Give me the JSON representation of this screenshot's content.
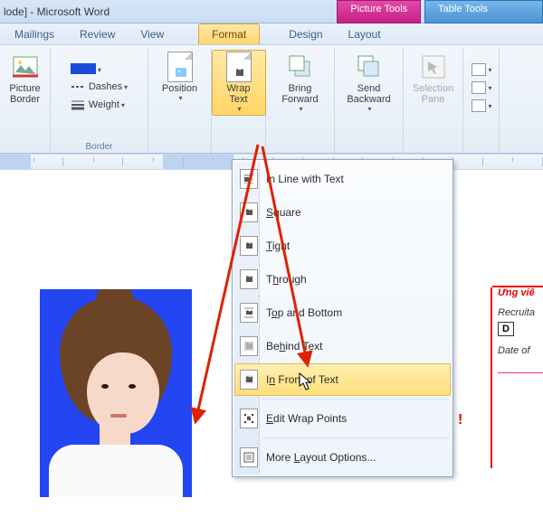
{
  "titlebar": {
    "text": "lode] - Microsoft Word"
  },
  "contextual_tabs": {
    "picture_tools": "Picture Tools",
    "table_tools": "Table Tools"
  },
  "tabs": {
    "mailings": "Mailings",
    "review": "Review",
    "view": "View",
    "format": "Format",
    "design": "Design",
    "layout": "Layout"
  },
  "ribbon": {
    "border": {
      "swatch_color": "#1b4bd8",
      "dashes": "Dashes",
      "weight": "Weight",
      "picture_border": "Picture\nBorder",
      "group": "Border"
    },
    "arrange": {
      "position": "Position",
      "wrap_text": "Wrap\nText",
      "bring_forward": "Bring\nForward",
      "send_backward": "Send\nBackward",
      "selection_pane": "Selection\nPane"
    }
  },
  "menu": {
    "inline": "In Line with Text",
    "square": "Square",
    "tight": "Tight",
    "through": "Through",
    "top_bottom": "Top and Bottom",
    "behind": "Behind Text",
    "in_front": "In Front of Text",
    "edit_points": "Edit Wrap Points",
    "more": "More Layout Options..."
  },
  "form": {
    "heading": "Ứng viê",
    "recruit": "Recruita",
    "box": "D",
    "date": "Date of"
  },
  "redslash": "!"
}
